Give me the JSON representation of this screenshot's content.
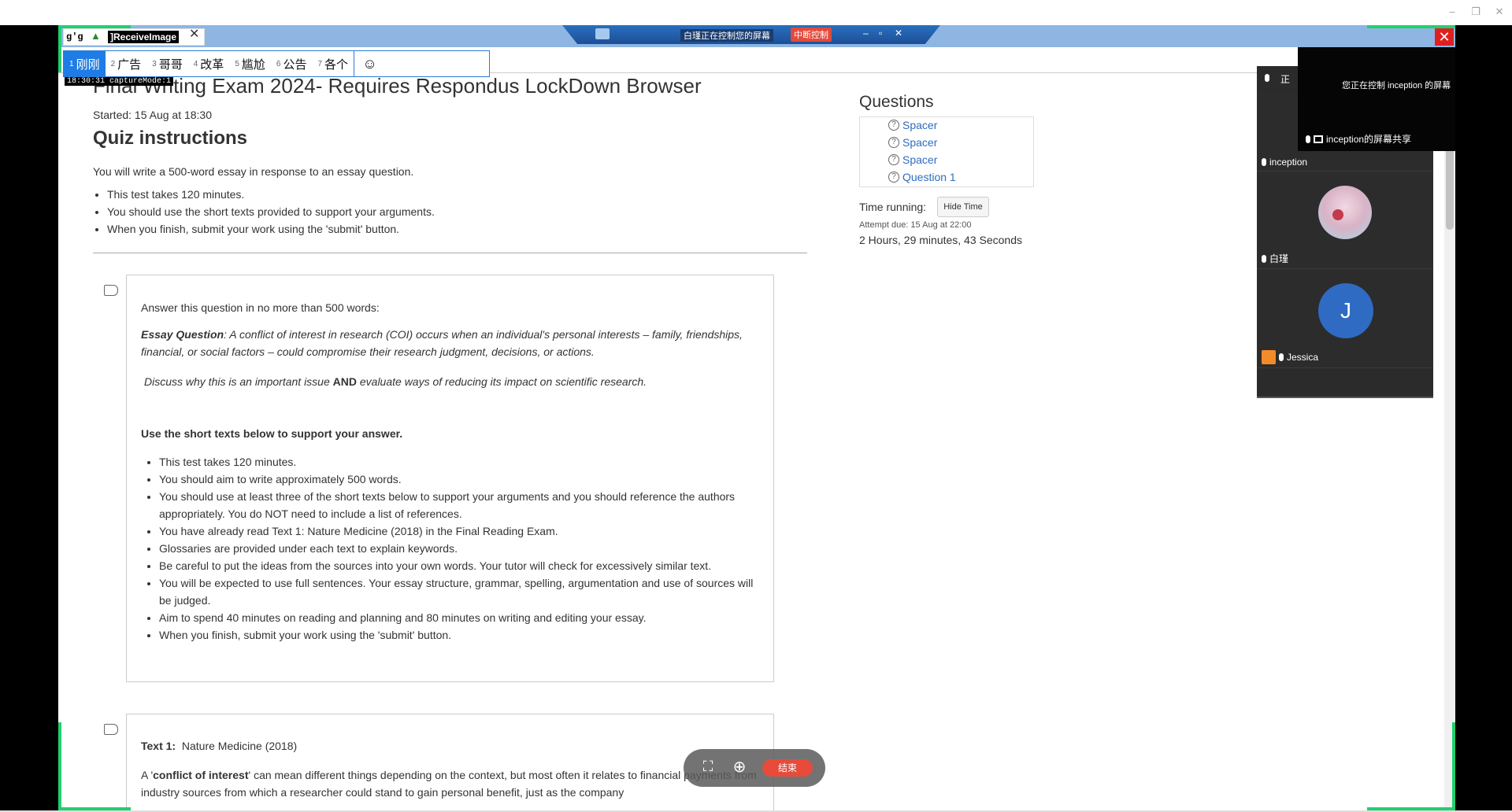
{
  "window": {
    "minimize": "–",
    "restore": "❐",
    "close": "✕"
  },
  "capture_tab": {
    "prefix": "g'g",
    "label": "]ReceiveImage",
    "close": "✕",
    "capture_mode": "18:30:31 captureMode:1"
  },
  "control_bar": {
    "message": "白瑾正在控制您的屏幕",
    "stop_label": "中断控制",
    "min": "–",
    "max": "▫",
    "close": "✕"
  },
  "tabs": [
    {
      "num": "1",
      "label": "刚刚"
    },
    {
      "num": "2",
      "label": "广告"
    },
    {
      "num": "3",
      "label": "哥哥"
    },
    {
      "num": "4",
      "label": "改革"
    },
    {
      "num": "5",
      "label": "尴尬"
    },
    {
      "num": "6",
      "label": "公告"
    },
    {
      "num": "7",
      "label": "各个"
    }
  ],
  "emoji_label": "☺",
  "quiz": {
    "title": "Final Writing Exam 2024- Requires Respondus LockDown Browser",
    "started": "Started: 15 Aug at 18:30",
    "instructions_heading": "Quiz instructions",
    "intro": "You will write a 500-word essay in response to an essay question.",
    "intro_items": [
      "This test takes 120 minutes.",
      "You should use the short texts provided to support your arguments.",
      "When you finish, submit your work using the 'submit' button."
    ],
    "q1": {
      "prompt": "Answer this question in no more than 500 words:",
      "essay_label": "Essay Question",
      "essay_text": ": A conflict of interest in research (COI) occurs when an individual's personal interests – family, friendships, financial, or social factors – could compromise their research judgment, decisions, or actions.",
      "discuss_a": "Discuss why this is an important issue ",
      "discuss_and": "AND",
      "discuss_b": " evaluate ways of reducing its impact on scientific research.",
      "support_heading": "Use the short texts below to support your answer.",
      "items": [
        "This test takes 120 minutes.",
        "You should aim to write approximately 500 words.",
        "You should use at least three of  the short texts below to support your arguments and you should reference the authors appropriately. You do NOT need to include a list of references.",
        "You have already read Text 1: Nature Medicine (2018) in the Final Reading Exam.",
        "Glossaries are provided under each text to explain keywords.",
        "Be careful to put the ideas from the sources into your own words. Your tutor will check for excessively similar text.",
        "You will be expected to use full sentences. Your essay structure, grammar, spelling, argumentation and use of sources will be judged.",
        "Aim to spend 40 minutes on reading and planning and 80 minutes on writing and editing your essay.",
        "When you finish, submit your work using the 'submit' button."
      ]
    },
    "q2": {
      "text_label": "Text 1:",
      "text_source": "Nature Medicine (2018)",
      "para_a": "A '",
      "para_term": "conflict of interest",
      "para_b": "' can mean different things depending on the context, but most often it relates to financial payments from industry sources from which a researcher could stand to gain personal benefit, just as the company"
    }
  },
  "sidebar": {
    "heading": "Questions",
    "items": [
      "Spacer",
      "Spacer",
      "Spacer",
      "Question 1"
    ],
    "time_running": "Time running:",
    "hide_time": "Hide Time",
    "attempt_due": "Attempt due: 15 Aug at 22:00",
    "time_left": "2 Hours, 29 minutes, 43 Seconds"
  },
  "video": {
    "popup_text": "您正在控制 inception 的屏幕",
    "popup_share": "inception的屏幕共享",
    "side_label": "正",
    "participants": [
      {
        "name": "inception"
      },
      {
        "name": "白瑾"
      },
      {
        "name": "Jessica",
        "initial": "J"
      }
    ]
  },
  "float_bar": {
    "end_label": "结束"
  }
}
